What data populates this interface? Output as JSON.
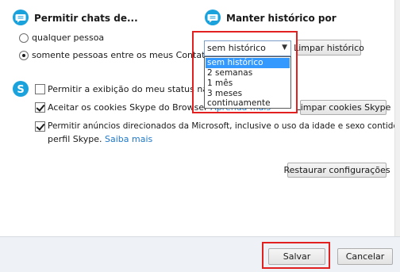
{
  "chats": {
    "heading": "Permitir chats de...",
    "options": [
      "qualquer pessoa",
      "somente pessoas entre os meus Contatos"
    ],
    "selected_index": 1
  },
  "history": {
    "heading": "Manter histórico por",
    "selected_value": "sem histórico",
    "options": [
      "sem histórico",
      "2 semanas",
      "1 mês",
      "3 meses",
      "continuamente"
    ],
    "clear_button": "Limpar histórico"
  },
  "privacy": {
    "status_label": "Permitir a exibição do meu status na web",
    "status_checked": false,
    "cookies_label": "Aceitar os cookies Skype do Browser",
    "cookies_link": "Aprenda mais",
    "cookies_checked": true,
    "clear_cookies_button": "Limpar cookies Skype",
    "ads_label_line1": "Permitir anúncios direcionados da Microsoft, inclusive o uso da idade e sexo contidos no",
    "ads_label_line2": "perfil Skype.",
    "ads_link": "Saiba mais",
    "ads_checked": true
  },
  "restore_button": "Restaurar configurações",
  "footer": {
    "save_button": "Salvar",
    "cancel_button": "Cancelar"
  },
  "colors": {
    "accent": "#1aa2dd",
    "highlight_box": "#e22020",
    "link": "#1f78c8",
    "selected_option": "#3399ff"
  }
}
